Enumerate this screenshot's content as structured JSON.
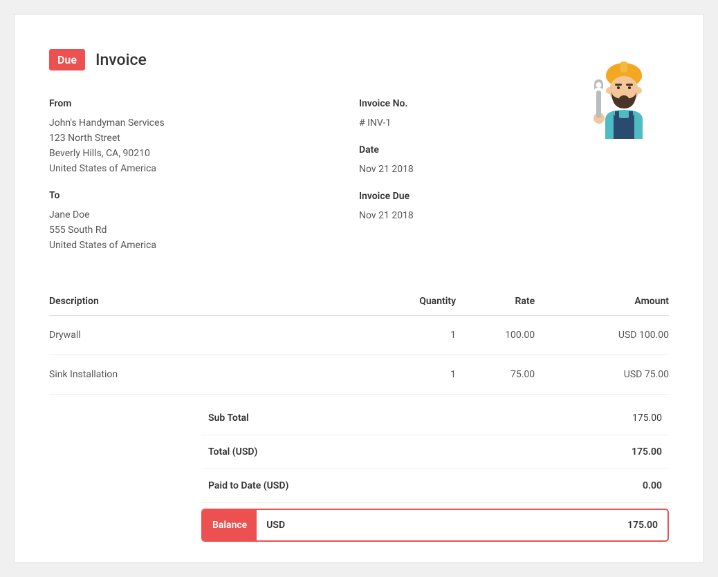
{
  "badge": "Due",
  "title": "Invoice",
  "from": {
    "label": "From",
    "name": "John's Handyman Services",
    "line1": "123 North Street",
    "line2": "Beverly Hills, CA, 90210",
    "line3": "United States of America"
  },
  "to": {
    "label": "To",
    "name": "Jane Doe",
    "line1": "555 South Rd",
    "line2": "United States of America"
  },
  "meta": {
    "invoice_no_label": "Invoice No.",
    "invoice_no": "# INV-1",
    "date_label": "Date",
    "date": "Nov 21 2018",
    "due_label": "Invoice Due",
    "due": "Nov 21 2018"
  },
  "columns": {
    "description": "Description",
    "quantity": "Quantity",
    "rate": "Rate",
    "amount": "Amount"
  },
  "items": [
    {
      "description": "Drywall",
      "quantity": "1",
      "rate": "100.00",
      "amount": "USD 100.00"
    },
    {
      "description": "Sink Installation",
      "quantity": "1",
      "rate": "75.00",
      "amount": "USD 75.00"
    }
  ],
  "totals": {
    "subtotal_label": "Sub Total",
    "subtotal": "175.00",
    "total_label": "Total (USD)",
    "total": "175.00",
    "paid_label": "Paid to Date (USD)",
    "paid": "0.00",
    "balance_label": "Balance",
    "balance_currency": "USD",
    "balance": "175.00"
  }
}
